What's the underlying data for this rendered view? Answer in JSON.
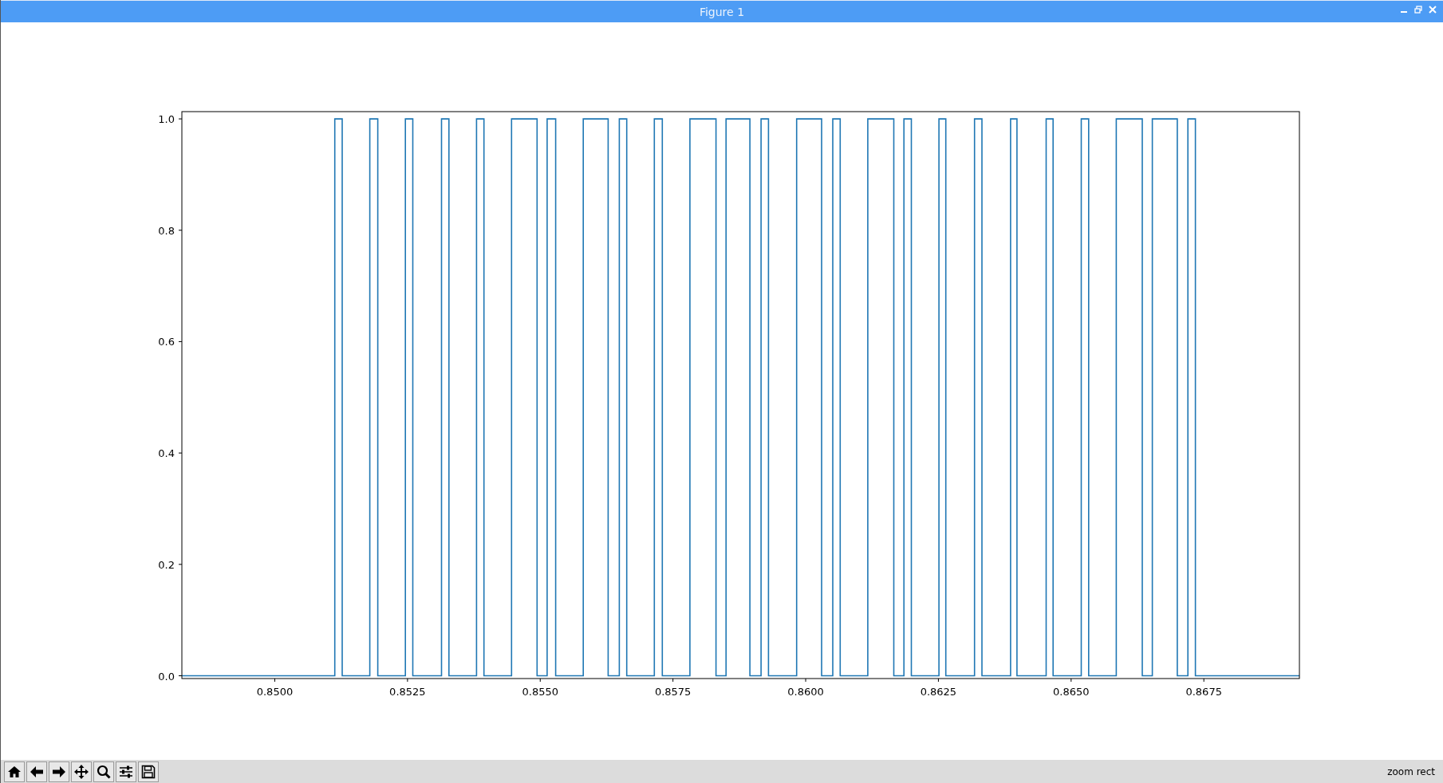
{
  "window": {
    "title": "Figure 1"
  },
  "figure": {
    "chart_data": {
      "type": "line",
      "xlim": [
        0.84825,
        0.8693
      ],
      "ylim": [
        -0.005,
        1.013
      ],
      "xticks": [
        {
          "value": 0.85,
          "label": "0.8500"
        },
        {
          "value": 0.8525,
          "label": "0.8525"
        },
        {
          "value": 0.855,
          "label": "0.8550"
        },
        {
          "value": 0.8575,
          "label": "0.8575"
        },
        {
          "value": 0.86,
          "label": "0.8600"
        },
        {
          "value": 0.8625,
          "label": "0.8625"
        },
        {
          "value": 0.865,
          "label": "0.8650"
        },
        {
          "value": 0.8675,
          "label": "0.8675"
        }
      ],
      "yticks": [
        {
          "value": 0,
          "label": "0.0"
        },
        {
          "value": 0.2,
          "label": "0.2"
        },
        {
          "value": 0.4,
          "label": "0.4"
        },
        {
          "value": 0.6,
          "label": "0.6"
        },
        {
          "value": 0.8,
          "label": "0.8"
        },
        {
          "value": 1,
          "label": "1.0"
        }
      ],
      "x": [
        0.84825,
        0.85113,
        0.85113,
        0.85127,
        0.85127,
        0.85179,
        0.85179,
        0.85194,
        0.85194,
        0.85246,
        0.85246,
        0.8526,
        0.8526,
        0.85314,
        0.85314,
        0.85328,
        0.85328,
        0.8538,
        0.8538,
        0.85394,
        0.85394,
        0.85446,
        0.85446,
        0.85494,
        0.85494,
        0.85513,
        0.85513,
        0.85529,
        0.85529,
        0.85581,
        0.85581,
        0.85628,
        0.85628,
        0.85649,
        0.85649,
        0.85663,
        0.85663,
        0.85715,
        0.85715,
        0.8573,
        0.8573,
        0.85782,
        0.85782,
        0.85831,
        0.85831,
        0.8585,
        0.8585,
        0.85895,
        0.85895,
        0.85916,
        0.85916,
        0.8593,
        0.8593,
        0.85983,
        0.85983,
        0.8603,
        0.8603,
        0.86051,
        0.86051,
        0.86065,
        0.86065,
        0.86117,
        0.86117,
        0.86166,
        0.86166,
        0.86185,
        0.86185,
        0.86199,
        0.86199,
        0.86251,
        0.86251,
        0.86264,
        0.86264,
        0.86318,
        0.86318,
        0.86332,
        0.86332,
        0.86386,
        0.86386,
        0.86398,
        0.86398,
        0.86453,
        0.86453,
        0.86466,
        0.86466,
        0.86519,
        0.86519,
        0.86533,
        0.86533,
        0.86585,
        0.86585,
        0.86634,
        0.86634,
        0.86653,
        0.86653,
        0.867,
        0.867,
        0.8672,
        0.8672,
        0.86734,
        0.86734,
        0.8693
      ],
      "series": [
        {
          "color": "#1f77b4",
          "values": [
            0,
            0,
            1,
            1,
            0,
            0,
            1,
            1,
            0,
            0,
            1,
            1,
            0,
            0,
            1,
            1,
            0,
            0,
            1,
            1,
            0,
            0,
            1,
            1,
            0,
            0,
            1,
            1,
            0,
            0,
            1,
            1,
            0,
            0,
            1,
            1,
            0,
            0,
            1,
            1,
            0,
            0,
            1,
            1,
            0,
            0,
            1,
            1,
            0,
            0,
            1,
            1,
            0,
            0,
            1,
            1,
            0,
            0,
            1,
            1,
            0,
            0,
            1,
            1,
            0,
            0,
            1,
            1,
            0,
            0,
            1,
            1,
            0,
            0,
            1,
            1,
            0,
            0,
            1,
            1,
            0,
            0,
            1,
            1,
            0,
            0,
            1,
            1,
            0,
            0,
            1,
            1,
            0,
            0,
            1,
            1,
            0,
            0,
            1,
            1,
            0,
            0
          ]
        }
      ]
    }
  },
  "toolbar": {
    "buttons": [
      {
        "kind": "home"
      },
      {
        "kind": "back"
      },
      {
        "kind": "forward"
      },
      {
        "kind": "pan"
      },
      {
        "kind": "zoom"
      },
      {
        "kind": "configure"
      },
      {
        "kind": "save"
      }
    ],
    "message": "zoom rect"
  }
}
